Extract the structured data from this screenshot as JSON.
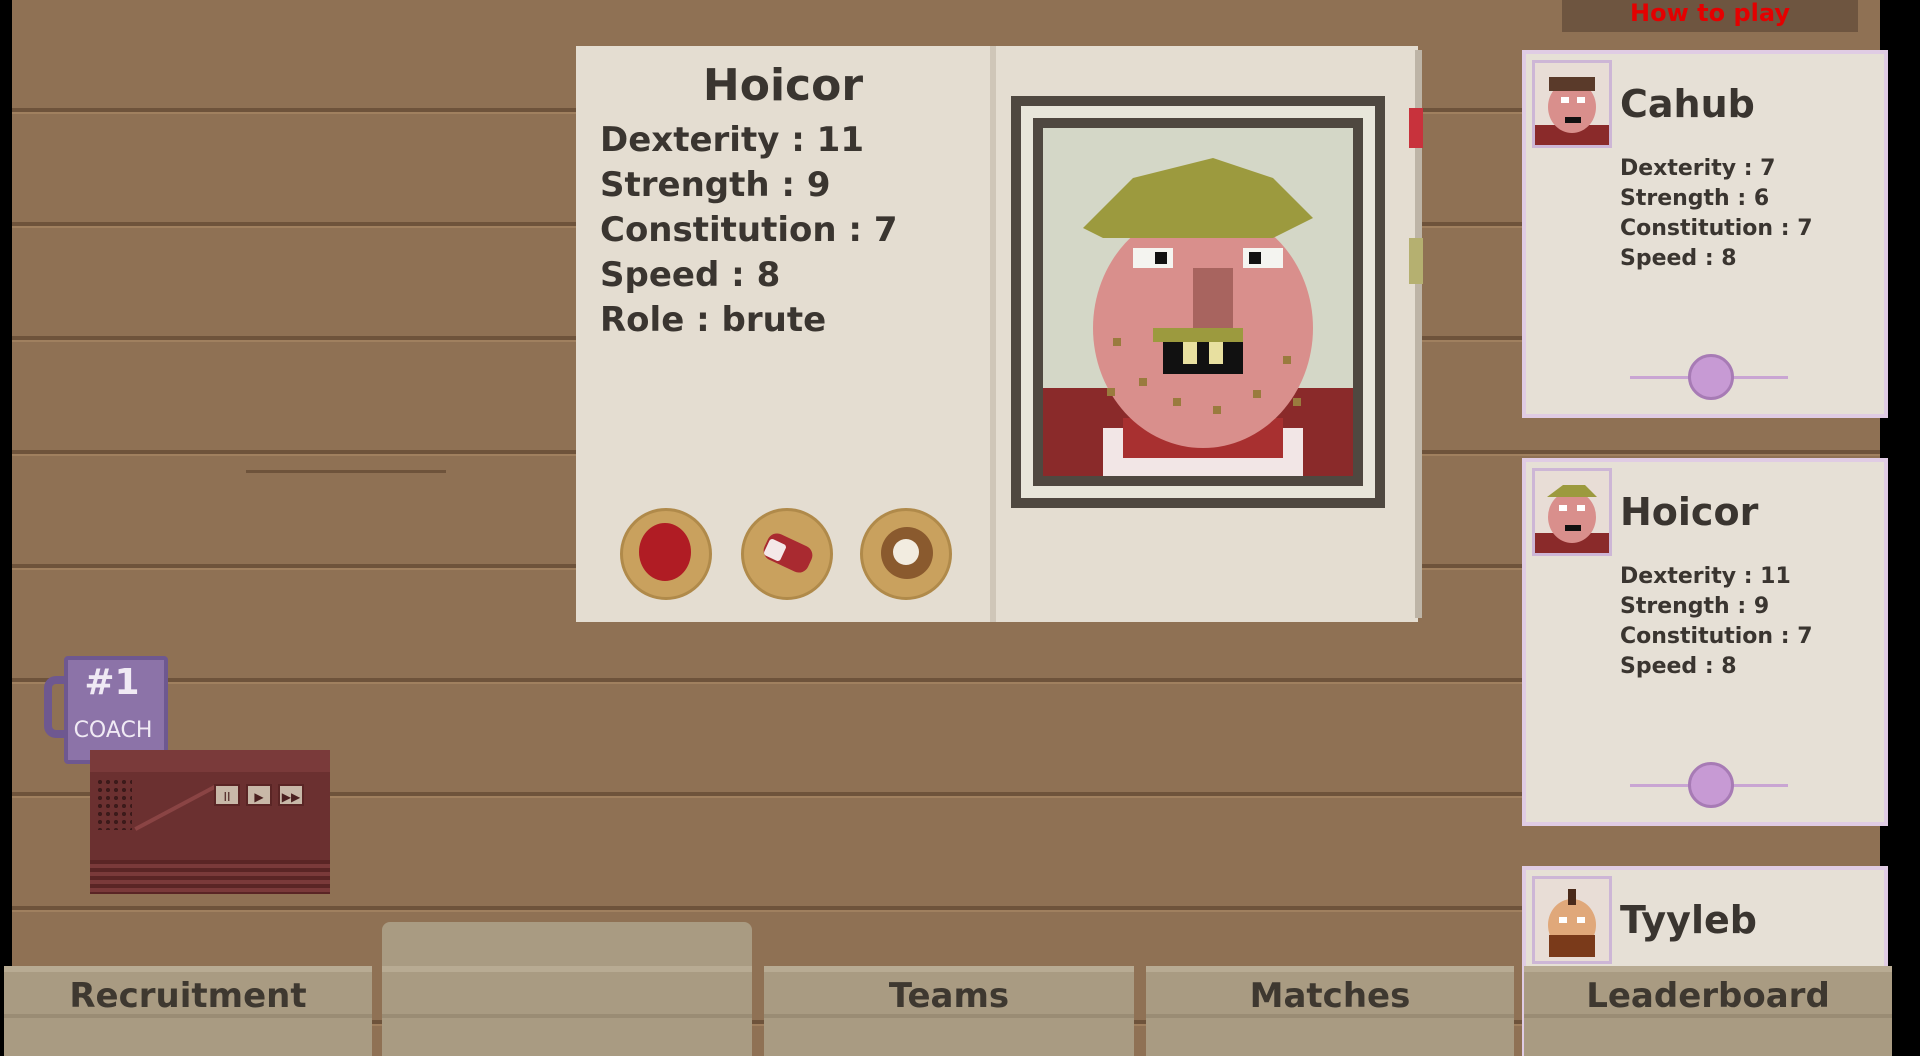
{
  "header": {
    "howto_label": "How to play"
  },
  "selected_player": {
    "name": "Hoicor",
    "stats": [
      {
        "label": "Dexterity",
        "value": "11"
      },
      {
        "label": "Strength",
        "value": "9"
      },
      {
        "label": "Constitution",
        "value": "7"
      },
      {
        "label": "Speed",
        "value": "8"
      },
      {
        "label": "Role",
        "value": "brute"
      }
    ]
  },
  "mug": {
    "number": "#1",
    "label": "COACH"
  },
  "radio": {
    "buttons": [
      "II",
      "▶",
      "▶▶"
    ]
  },
  "roster": [
    {
      "name": "Cahub",
      "stats": [
        "Dexterity : 7",
        "Strength : 6",
        "Constitution : 7",
        "Speed : 8"
      ]
    },
    {
      "name": "Hoicor",
      "stats": [
        "Dexterity : 11",
        "Strength : 9",
        "Constitution : 7",
        "Speed : 8"
      ]
    },
    {
      "name": "Tyyleb",
      "stats": []
    }
  ],
  "tabs": [
    {
      "label": "Recruitment"
    },
    {
      "label": ""
    },
    {
      "label": "Teams"
    },
    {
      "label": "Matches"
    },
    {
      "label": "Leaderboard"
    }
  ],
  "colors": {
    "wood": "#8f7154",
    "paper": "#e4ddd1",
    "howto_text": "#e40000",
    "card_border": "#e0cce4"
  }
}
